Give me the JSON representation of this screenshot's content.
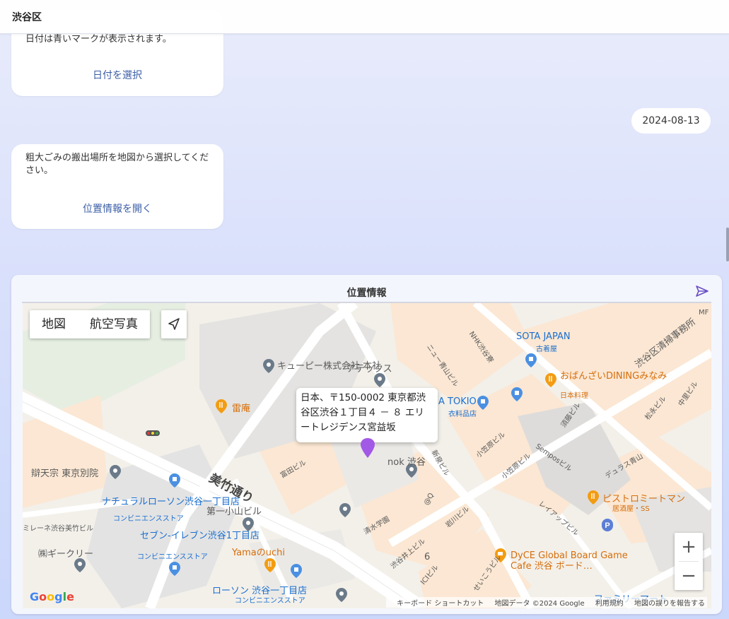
{
  "header": {
    "title": "渋谷区"
  },
  "messages": {
    "date_bubble": {
      "text": "日付は青いマークが表示されます。",
      "action": "日付を選択"
    },
    "date_reply": "2024-08-13",
    "location_bubble": {
      "text": "粗大ごみの搬出場所を地図から選択してください。",
      "action": "位置情報を開く"
    }
  },
  "location_card": {
    "title": "位置情報",
    "map_type": {
      "map": "地図",
      "satellite": "航空写真"
    },
    "info_window": "日本、〒150-0002 東京都渋谷区渋谷１丁目４ － ８ エリートレジデンス宮益坂",
    "zoom_in": "+",
    "zoom_out": "−",
    "google_logo": "Google",
    "attribution": {
      "shortcuts": "キーボード ショートカット",
      "map_data": "地図データ ©2024 Google",
      "terms": "利用規約",
      "report": "地図の誤りを報告する"
    },
    "labels": {
      "kewpie": "キューピー株式会社 本社",
      "atex": "アテックス",
      "raian": "雷庵",
      "nok": "nok 渋谷",
      "sota": "SOTA JAPAN",
      "sota_sub": "古着屋",
      "obanzai": "おばんざいDININGみなみ",
      "obanzai_sub": "日本料理",
      "tokio": "A TOKIO",
      "tokio_sub": "衣料品店",
      "shibuya_clean": "渋谷区清掃事務所",
      "road": "美竹通り",
      "benten": "辯天宗 東京別院",
      "natural_lawson": "ナチュラルローソン渋谷一丁目店",
      "conv": "コンビニエンスストア",
      "seven": "セブン-イレブン渋谷1丁目店",
      "daiichi": "第一小山ビル",
      "yamauchi": "Yamaのuchi",
      "lawson": "ローソン 渋谷一丁目店",
      "gecreer": "㈱ギークリー",
      "irene": "ミレーネ渋谷美竹ビル",
      "pistro": "ピストロミートマン",
      "pistro_sub": "居酒屋・SS",
      "dyce": "DyCE Global Board Game Cafe 渋谷 ボード…",
      "family": "ファミリーマート",
      "tomita": "富田ビル",
      "shimizu": "清水学園",
      "at_q": "@Q",
      "iwakawa": "岩川ビル",
      "sempos": "Semposビル",
      "dyurasu": "デュラス青山",
      "layup": "レイアップビル",
      "kosahara": "小笠原ビル",
      "kosahara2": "小笠原ビル",
      "sudo": "須藤ビル",
      "matsue": "松永ビル",
      "nakamura": "中里ビル",
      "new_aoyama": "ニュー青山ビル",
      "nhk": "NHK渋谷寮",
      "shinsen": "新泉ビル",
      "inoue": "渋谷井上ビル",
      "ici": "ICIビル",
      "seiko": "せいこうビル",
      "num6": "6",
      "mf": "MF"
    },
    "colors": {
      "pin": "#a259e6",
      "accent": "#3b5ea6",
      "send": "#6a4fc4"
    }
  }
}
